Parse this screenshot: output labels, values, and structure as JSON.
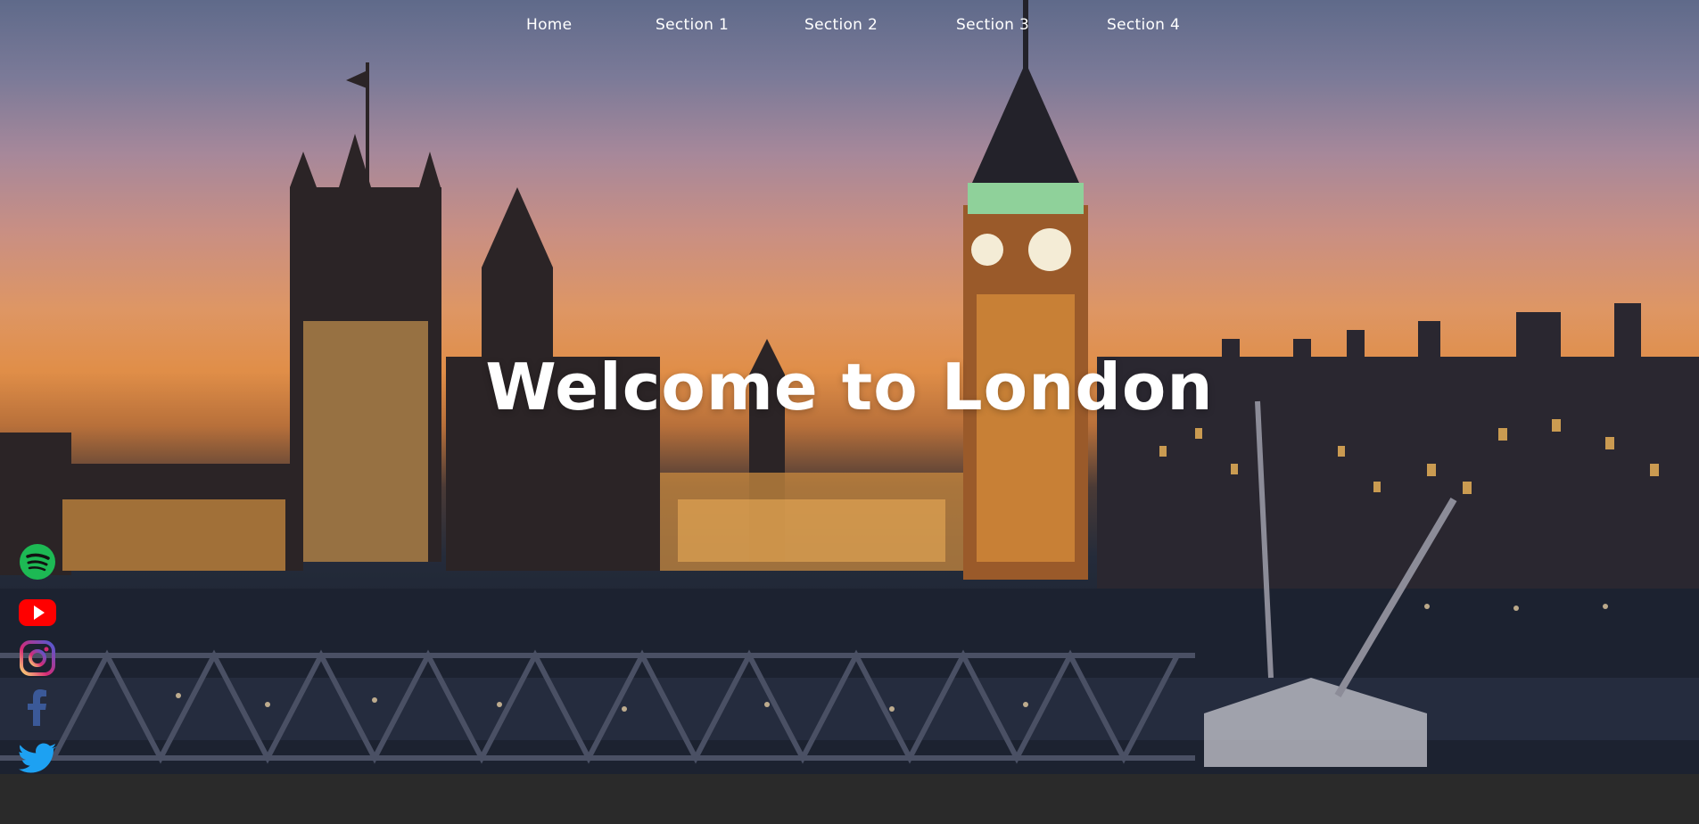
{
  "nav": {
    "items": [
      {
        "label": "Home"
      },
      {
        "label": "Section 1"
      },
      {
        "label": "Section 2"
      },
      {
        "label": "Section 3"
      },
      {
        "label": "Section 4"
      }
    ]
  },
  "hero": {
    "headline": "Welcome to London"
  },
  "social": {
    "icons": [
      "spotify-icon",
      "youtube-icon",
      "instagram-icon",
      "facebook-icon",
      "twitter-icon"
    ],
    "colors": {
      "spotify": "#1DB954",
      "youtube": "#FF0000",
      "instagram": "#E1306C",
      "facebook": "#3B5998",
      "twitter": "#1DA1F2"
    }
  },
  "colors": {
    "footer": "#2a2a2a",
    "text": "#ffffff"
  }
}
